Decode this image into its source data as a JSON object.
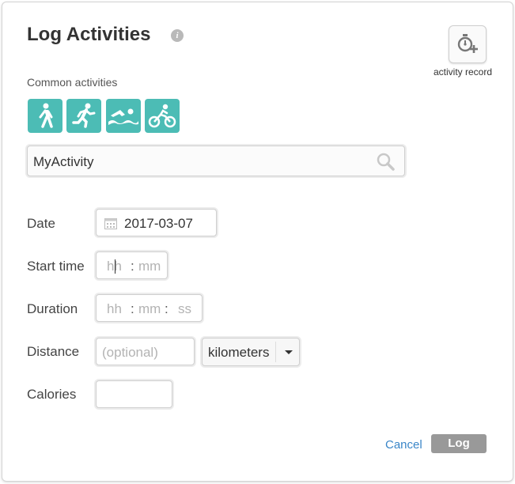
{
  "header": {
    "title": "Log Activities",
    "info_icon": "info-icon"
  },
  "record": {
    "label": "activity record",
    "icon": "stopwatch-plus-icon"
  },
  "common": {
    "label": "Common activities",
    "color": "#4cbcb5",
    "items": [
      {
        "name": "walking",
        "icon": "walking-icon"
      },
      {
        "name": "running",
        "icon": "running-icon"
      },
      {
        "name": "swimming",
        "icon": "swimming-icon"
      },
      {
        "name": "cycling",
        "icon": "cycling-icon"
      }
    ]
  },
  "search": {
    "value": "MyActivity",
    "icon": "search-icon"
  },
  "form": {
    "date": {
      "label": "Date",
      "value": "2017-03-07",
      "icon": "calendar-icon"
    },
    "start_time": {
      "label": "Start time",
      "hh": "hh",
      "sep": ":",
      "mm": "mm"
    },
    "duration": {
      "label": "Duration",
      "hh": "hh",
      "sep1": ":",
      "mm": "mm",
      "sep2": ":",
      "ss": "ss"
    },
    "distance": {
      "label": "Distance",
      "placeholder": "(optional)",
      "unit": "kilometers"
    },
    "calories": {
      "label": "Calories",
      "value": ""
    }
  },
  "actions": {
    "cancel": "Cancel",
    "log": "Log"
  }
}
